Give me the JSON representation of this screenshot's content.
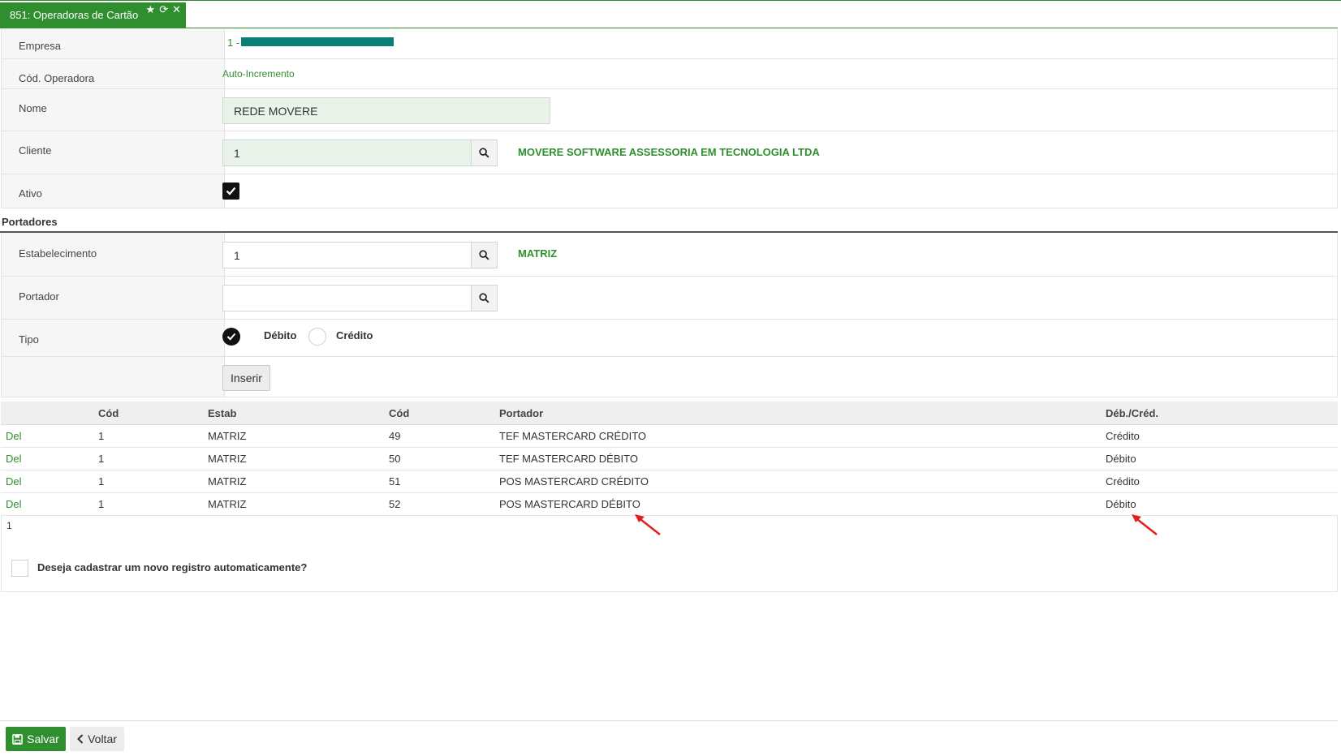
{
  "tab": {
    "title": "851: Operadoras de Cartão",
    "icons": [
      "star-icon",
      "refresh-icon",
      "close-icon"
    ]
  },
  "form": {
    "empresa": {
      "label": "Empresa",
      "value_prefix": "1 -"
    },
    "cod_operadora": {
      "label": "Cód. Operadora",
      "value": "Auto-Incremento"
    },
    "nome": {
      "label": "Nome",
      "value": "REDE MOVERE"
    },
    "cliente": {
      "label": "Cliente",
      "value": "1",
      "description": "MOVERE SOFTWARE ASSESSORIA EM TECNOLOGIA LTDA"
    },
    "ativo": {
      "label": "Ativo",
      "checked": true
    }
  },
  "portadores": {
    "section_title": "Portadores",
    "estabelecimento": {
      "label": "Estabelecimento",
      "value": "1",
      "description": "MATRIZ"
    },
    "portador": {
      "label": "Portador",
      "value": ""
    },
    "tipo": {
      "label": "Tipo",
      "options": [
        "Débito",
        "Crédito"
      ],
      "selected": "Débito"
    },
    "inserir_label": "Inserir"
  },
  "grid": {
    "headers": [
      "",
      "Cód",
      "Estab",
      "Cód",
      "Portador",
      "Déb./Créd."
    ],
    "rows": [
      {
        "action": "Del",
        "cod_estab": "1",
        "estab": "MATRIZ",
        "cod_portador": "49",
        "portador": "TEF MASTERCARD CRÉDITO",
        "tipo": "Crédito"
      },
      {
        "action": "Del",
        "cod_estab": "1",
        "estab": "MATRIZ",
        "cod_portador": "50",
        "portador": "TEF MASTERCARD DÉBITO",
        "tipo": "Débito"
      },
      {
        "action": "Del",
        "cod_estab": "1",
        "estab": "MATRIZ",
        "cod_portador": "51",
        "portador": "POS MASTERCARD CRÉDITO",
        "tipo": "Crédito"
      },
      {
        "action": "Del",
        "cod_estab": "1",
        "estab": "MATRIZ",
        "cod_portador": "52",
        "portador": "POS MASTERCARD DÉBITO",
        "tipo": "Débito"
      }
    ],
    "pager": "1"
  },
  "auto_register": {
    "label": "Deseja cadastrar um novo registro automaticamente?",
    "checked": false
  },
  "footer": {
    "save_label": "Salvar",
    "back_label": "Voltar"
  },
  "colors": {
    "accent": "#2f8f2f",
    "redacted": "#0a7f7a",
    "annotation_arrow": "#e02020"
  }
}
